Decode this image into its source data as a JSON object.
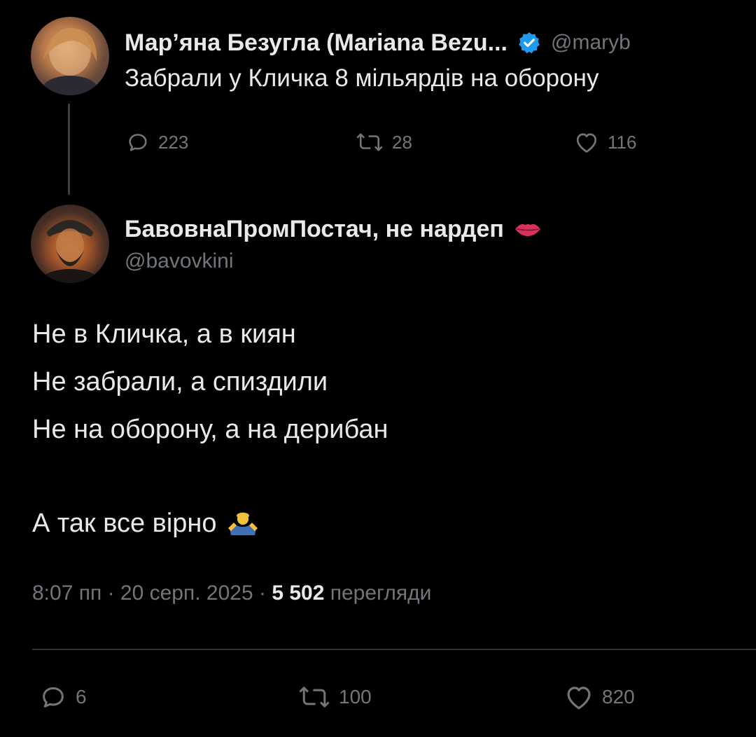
{
  "parent_tweet": {
    "display_name": "Мар’яна Безугла (Mariana Bezu...",
    "handle": "@maryb",
    "text": "Забрали у Кличка 8 мільярдів на оборону",
    "replies": "223",
    "reposts": "28",
    "likes": "116",
    "verified": true,
    "verified_color": "#1d9bf0"
  },
  "reply_tweet": {
    "display_name": "БавовнаПромПостач, не нардеп",
    "name_emoji": "lips-icon",
    "handle": "@bavovkini",
    "lines": [
      "Не в Кличка, а в киян",
      "Не забрали, а спиздили",
      "Не на оборону, а на дерибан",
      "А так все вірно"
    ],
    "trailing_emoji": "man-shrugging-icon",
    "time": "8:07 пп",
    "separator": "·",
    "date": "20 серп. 2025",
    "views_count": "5 502",
    "views_label": "перегляди",
    "replies": "6",
    "reposts": "100",
    "likes": "820"
  },
  "colors": {
    "background": "#000000",
    "text_primary": "#e7e9ea",
    "text_secondary": "#71767b",
    "divider": "#2f3336"
  }
}
